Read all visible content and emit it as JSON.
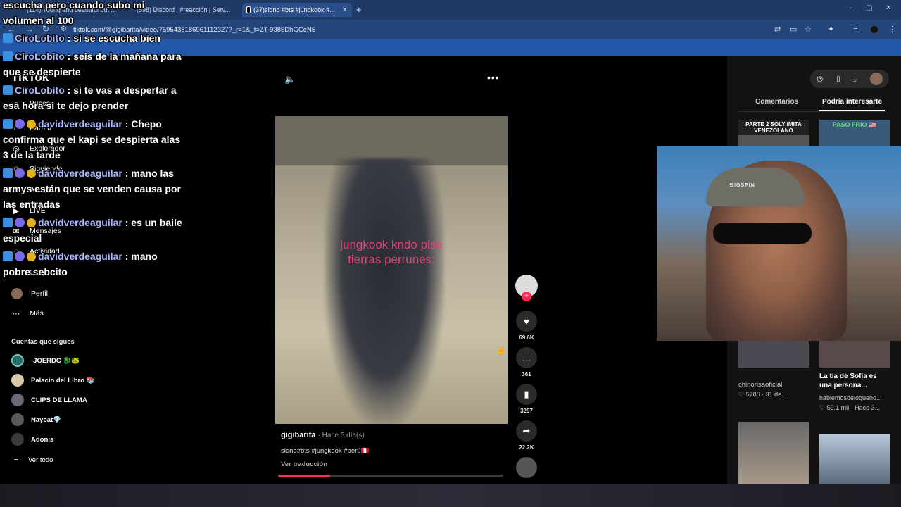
{
  "browser": {
    "tabs": [
      {
        "label": "(114) Young and beautiful but ..."
      },
      {
        "label": "(598) Discord | #reacción | Serv..."
      },
      {
        "label": "(37)siono #bts #jungkook #..."
      }
    ],
    "url": "tiktok.com/@gigibarita/video/7595438186961112327?_r=1&_t=ZT-9385DhGCeN5",
    "new_tab": "+"
  },
  "tiktok": {
    "logo": "TikTok",
    "nav": [
      {
        "label": "Buscar",
        "icon": "search-icon"
      },
      {
        "label": "Para ti",
        "icon": "home-icon"
      },
      {
        "label": "Explorador",
        "icon": "compass-icon"
      },
      {
        "label": "Siguiendo",
        "icon": "following-icon"
      },
      {
        "label": "Amigos",
        "icon": "friends-icon"
      },
      {
        "label": "LIVE",
        "icon": "live-icon"
      },
      {
        "label": "Mensajes",
        "icon": "messages-icon"
      },
      {
        "label": "Actividad",
        "icon": "activity-icon"
      },
      {
        "label": "Cargar",
        "icon": "upload-icon"
      },
      {
        "label": "Perfil",
        "icon": "profile-icon"
      },
      {
        "label": "Más",
        "icon": "more-icon"
      }
    ],
    "following_header": "Cuentas que sigues",
    "following": [
      {
        "name": "-JOERDC 🐉🐸"
      },
      {
        "name": "Palacio del Libro 📚"
      },
      {
        "name": "CLIPS DE LLAMA"
      },
      {
        "name": "Naycat💎"
      },
      {
        "name": "Adonis"
      }
    ],
    "see_all": "Ver todo"
  },
  "video": {
    "overlay_text_line1": "jungkook kndo pise",
    "overlay_text_line2": "tierras perrunes:",
    "author": "gigibarita",
    "age": "· Hace 5 día(s)",
    "caption": "siono#bts #jungkook #perú🇵🇪",
    "translate": "Ver traducción",
    "progress": 0.23,
    "accent": "#fe2c55",
    "actions": [
      {
        "icon": "heart-icon",
        "count": "69.6K"
      },
      {
        "icon": "comment-icon",
        "count": "361"
      },
      {
        "icon": "bookmark-icon",
        "count": "3297"
      },
      {
        "icon": "share-icon",
        "count": "22.2K"
      }
    ]
  },
  "right_panel": {
    "tab_comments": "Comentarios",
    "tab_interest": "Podría interesarte",
    "thumb1_label": "PARTE 2 SOLY IMITA VENEZOLANO",
    "thumb2_label": "PASO FRIO 🇺🇸",
    "item1_meta_user": "chinorisaoficial",
    "item1_meta_stats": "♡ 5786 · 31 de...",
    "item2_title": "La tía de Sofía es una persona...",
    "item2_user": "hablemosdeloqueno...",
    "item2_stats": "♡ 59.1 mil · Hace 3..."
  },
  "chat": [
    {
      "user": "",
      "text": "escucha pero cuando subo mi volumen al 100"
    },
    {
      "user": "CiroLobito",
      "text": "si se escucha bien"
    },
    {
      "user": "CiroLobito",
      "text": "seis de la mañana para que se despierte"
    },
    {
      "user": "CiroLobito",
      "text": "si te vas a despertar a esa hora si te dejo prender"
    },
    {
      "user": "davidverdeaguilar",
      "text": "Chepo confirma que el kapi se despierta alas 3 de la tarde"
    },
    {
      "user": "davidverdeaguilar",
      "text": "mano las armys están que se venden causa por las entradas"
    },
    {
      "user": "davidverdeaguilar",
      "text": "es un baile especial"
    },
    {
      "user": "davidverdeaguilar",
      "text": "mano pobre sebcito"
    }
  ],
  "webcam": {
    "cap_text": "BIGSPIN"
  }
}
